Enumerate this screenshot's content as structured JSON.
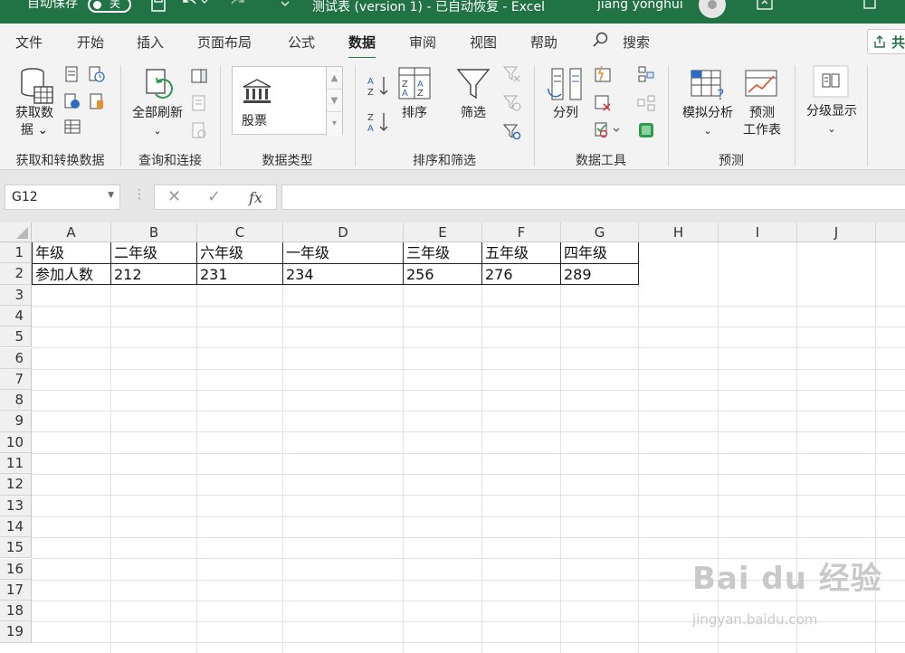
{
  "titlebar": {
    "autosave_label": "自动保存",
    "autosave_state": "关",
    "document": "测试表 (version 1)  -  已自动恢复  -  Excel",
    "user": "jiang yonghui"
  },
  "tabs": [
    "文件",
    "开始",
    "插入",
    "页面布局",
    "公式",
    "数据",
    "审阅",
    "视图",
    "帮助"
  ],
  "active_tab": "数据",
  "search_label": "搜索",
  "share_label": "共",
  "ribbon": {
    "get_data": "获取数\n据",
    "get_data_line1": "获取数",
    "get_data_line2": "据 ⌄",
    "refresh_all": "全部刷新",
    "stocks": "股票",
    "sort": "排序",
    "filter": "筛选",
    "text_to_columns": "分列",
    "what_if": "模拟分析",
    "forecast_sheet_line1": "预测",
    "forecast_sheet_line2": "工作表",
    "outline": "分级显示",
    "groups": {
      "get_transform": "获取和转换数据",
      "queries": "查询和连接",
      "data_types": "数据类型",
      "sort_filter": "排序和筛选",
      "data_tools": "数据工具",
      "forecast": "预测"
    }
  },
  "formula_bar": {
    "name_box": "G12",
    "fx": "fx",
    "value": ""
  },
  "columns": [
    "A",
    "B",
    "C",
    "D",
    "E",
    "F",
    "G",
    "H",
    "I",
    "J"
  ],
  "rows": [
    "1",
    "2",
    "3",
    "4",
    "5",
    "6",
    "7",
    "8",
    "9",
    "10",
    "11",
    "12",
    "13",
    "14",
    "15",
    "16",
    "17",
    "18",
    "19"
  ],
  "sheet": {
    "row1": [
      "年级",
      "二年级",
      "六年级",
      "一年级",
      "三年级",
      "五年级",
      "四年级"
    ],
    "row2": [
      "参加人数",
      "212",
      "231",
      "234",
      "256",
      "276",
      "289"
    ]
  },
  "watermark": {
    "brand": "Bai du 经验",
    "url": "jingyan.baidu.com"
  }
}
